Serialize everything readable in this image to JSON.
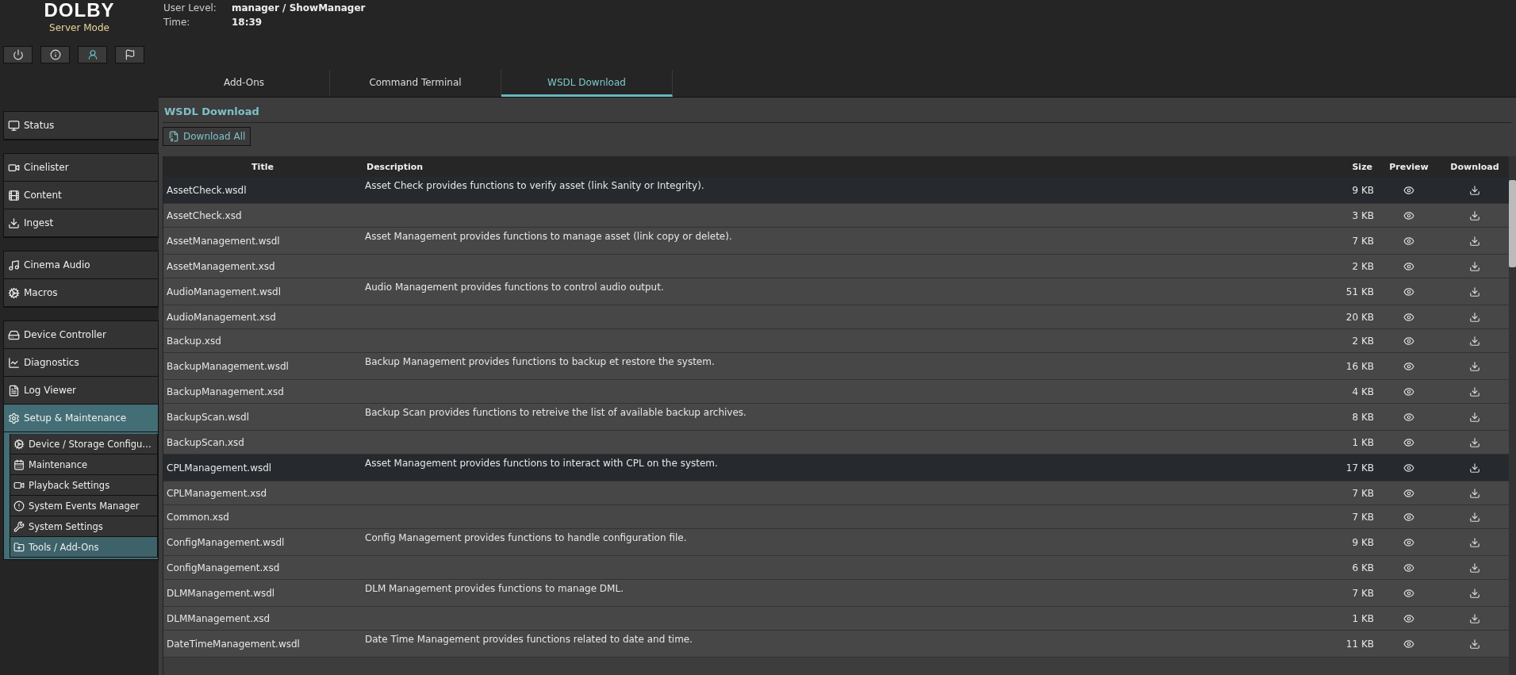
{
  "logo": "DOLBY",
  "mode": "Server Mode",
  "user_info": [
    {
      "label": "User Level:",
      "value": "manager / ShowManager"
    },
    {
      "label": "Time:",
      "value": "18:39"
    }
  ],
  "tabs": [
    {
      "label": "Add-Ons",
      "selected": false
    },
    {
      "label": "Command Terminal",
      "selected": false
    },
    {
      "label": "WSDL Download",
      "selected": true
    }
  ],
  "sidebar": {
    "groups": [
      [
        {
          "label": "Status",
          "selected": false
        }
      ],
      [
        {
          "label": "Cinelister",
          "selected": false
        },
        {
          "label": "Content",
          "selected": false
        },
        {
          "label": "Ingest",
          "selected": false
        }
      ],
      [
        {
          "label": "Cinema Audio",
          "selected": false
        },
        {
          "label": "Macros",
          "selected": false
        }
      ],
      [
        {
          "label": "Device Controller",
          "selected": false
        },
        {
          "label": "Diagnostics",
          "selected": false
        },
        {
          "label": "Log Viewer",
          "selected": false
        },
        {
          "label": "Setup & Maintenance",
          "selected": true,
          "expanded": true,
          "children": [
            {
              "label": "Device / Storage Configu…",
              "selected": false
            },
            {
              "label": "Maintenance",
              "selected": false
            },
            {
              "label": "Playback Settings",
              "selected": false
            },
            {
              "label": "System Events Manager",
              "selected": false
            },
            {
              "label": "System Settings",
              "selected": false
            },
            {
              "label": "Tools / Add-Ons",
              "selected": true
            }
          ]
        }
      ]
    ]
  },
  "panel": {
    "title": "WSDL Download",
    "download_all": "Download All",
    "table": {
      "columns": [
        "Title",
        "Description",
        "Size",
        "Preview",
        "Download"
      ],
      "rows": [
        {
          "title": "AssetCheck.wsdl",
          "description": "Asset Check provides functions to verify asset (link Sanity or Integrity).",
          "size": "9 KB",
          "selected": true
        },
        {
          "title": "AssetCheck.xsd",
          "size": "3 KB",
          "selected": false
        },
        {
          "title": "AssetManagement.wsdl",
          "description": "Asset Management provides functions to manage asset (link copy or delete).",
          "size": "7 KB",
          "selected": false
        },
        {
          "title": "AssetManagement.xsd",
          "size": "2 KB",
          "selected": false
        },
        {
          "title": "AudioManagement.wsdl",
          "description": "Audio Management provides functions to control audio output.",
          "size": "51 KB",
          "selected": false
        },
        {
          "title": "AudioManagement.xsd",
          "size": "20 KB",
          "selected": false
        },
        {
          "title": "Backup.xsd",
          "size": "2 KB",
          "selected": false
        },
        {
          "title": "BackupManagement.wsdl",
          "description": "Backup Management provides functions to backup et restore the system.",
          "size": "16 KB",
          "selected": false
        },
        {
          "title": "BackupManagement.xsd",
          "size": "4 KB",
          "selected": false
        },
        {
          "title": "BackupScan.wsdl",
          "description": "Backup Scan provides functions to retreive the list of available backup archives.",
          "size": "8 KB",
          "selected": false
        },
        {
          "title": "BackupScan.xsd",
          "size": "1 KB",
          "selected": false
        },
        {
          "title": "CPLManagement.wsdl",
          "description": "Asset Management provides functions to interact with CPL on the system.",
          "size": "17 KB",
          "selected": true
        },
        {
          "title": "CPLManagement.xsd",
          "size": "7 KB",
          "selected": false
        },
        {
          "title": "Common.xsd",
          "size": "7 KB",
          "selected": false
        },
        {
          "title": "ConfigManagement.wsdl",
          "description": "Config Management provides functions to handle configuration file.",
          "size": "9 KB",
          "selected": false
        },
        {
          "title": "ConfigManagement.xsd",
          "size": "6 KB",
          "selected": false
        },
        {
          "title": "DLMManagement.wsdl",
          "description": "DLM Management provides functions to manage DML.",
          "size": "7 KB",
          "selected": false
        },
        {
          "title": "DLMManagement.xsd",
          "size": "1 KB",
          "selected": false
        },
        {
          "title": "DateTimeManagement.wsdl",
          "description": "Date Time Management provides functions related to date and time.",
          "size": "11 KB",
          "selected": false
        }
      ]
    }
  }
}
